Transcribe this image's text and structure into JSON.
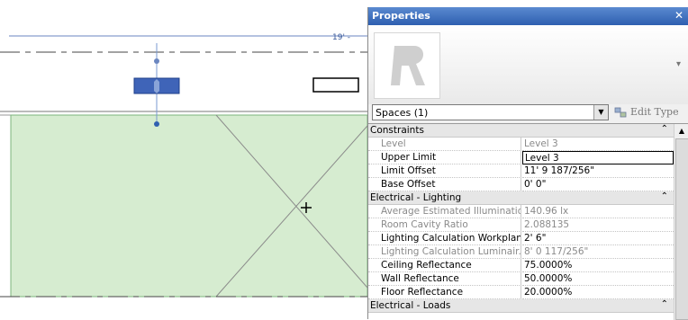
{
  "canvas": {
    "dimension_label": "19' - "
  },
  "panel": {
    "title": "Properties",
    "close_glyph": "✕",
    "preview_arrow_glyph": "▾",
    "type_selector_value": "Spaces (1)",
    "type_dropdown_glyph": "▼",
    "edit_type_label": "Edit Type"
  },
  "groups": [
    {
      "title": "Constraints",
      "collapse_glyph": "⌃",
      "rows": [
        {
          "name": "Level",
          "value": "Level 3"
        },
        {
          "name": "Upper Limit",
          "value": "Level 3"
        },
        {
          "name": "Limit Offset",
          "value": "11'  9 187/256\""
        },
        {
          "name": "Base Offset",
          "value": "0'  0\""
        }
      ]
    },
    {
      "title": "Electrical - Lighting",
      "collapse_glyph": "⌃",
      "rows": [
        {
          "name": "Average Estimated Illumination",
          "value": "140.96 lx"
        },
        {
          "name": "Room Cavity Ratio",
          "value": "2.088135"
        },
        {
          "name": "Lighting Calculation Workplane",
          "value": "2'  6\""
        },
        {
          "name": "Lighting Calculation Luminair...",
          "value": "8'  0 117/256\""
        },
        {
          "name": "Ceiling Reflectance",
          "value": "75.0000%"
        },
        {
          "name": "Wall Reflectance",
          "value": "50.0000%"
        },
        {
          "name": "Floor Reflectance",
          "value": "20.0000%"
        }
      ]
    },
    {
      "title": "Electrical - Loads",
      "collapse_glyph": "⌃",
      "rows": []
    }
  ],
  "scroll_up_glyph": "▲"
}
